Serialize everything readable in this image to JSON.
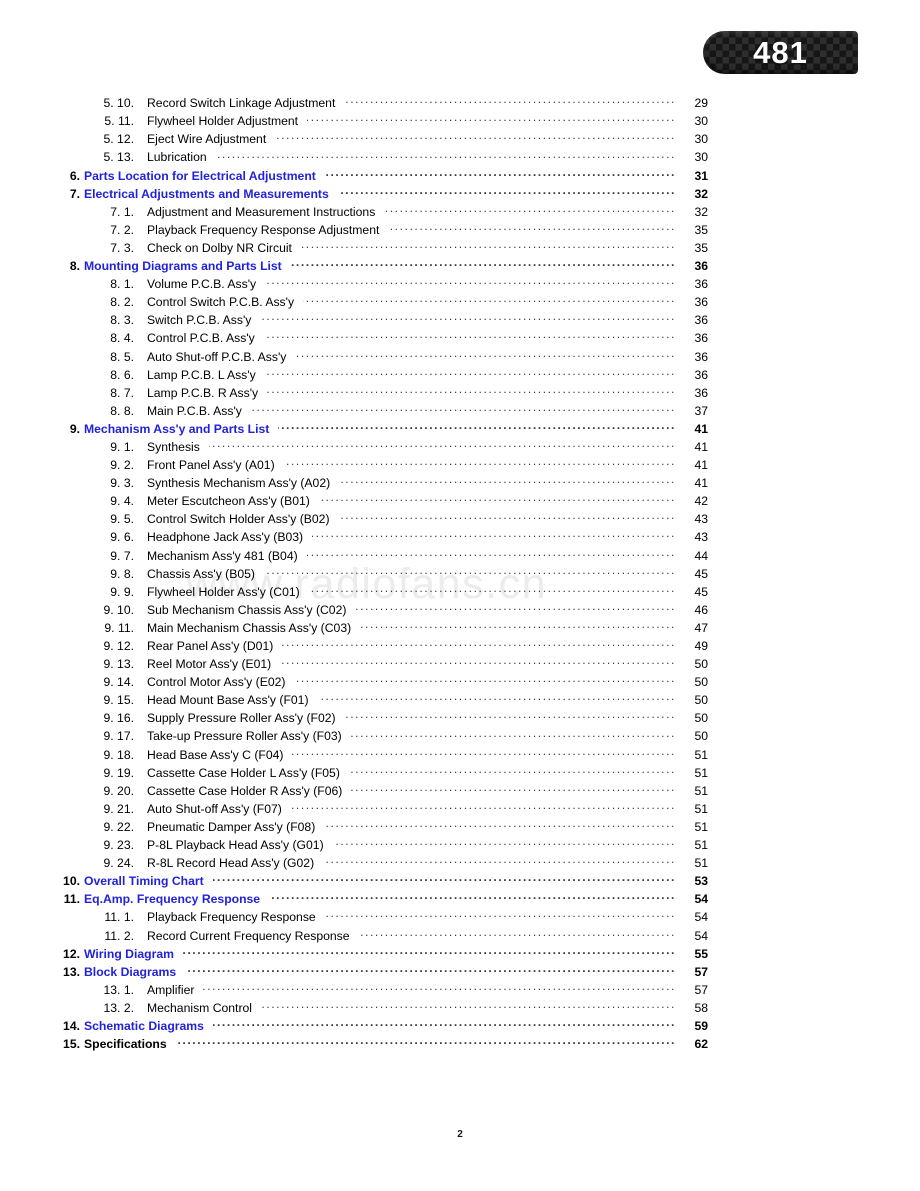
{
  "badge": {
    "number": "481"
  },
  "watermark": {
    "text": "www.radiofans.cn"
  },
  "footer": {
    "page_number": "2"
  },
  "colors": {
    "chapter_link": "#2222d8",
    "body_text": "#000000",
    "badge_background": "#161616",
    "badge_text": "#ffffff",
    "watermark": "#ececec"
  },
  "toc": {
    "rows": [
      {
        "level": 2,
        "num": "5. 10.",
        "title": "Record Switch Linkage Adjustment",
        "page": "29"
      },
      {
        "level": 2,
        "num": "5. 11.",
        "title": "Flywheel Holder Adjustment",
        "page": "30"
      },
      {
        "level": 2,
        "num": "5. 12.",
        "title": "Eject Wire Adjustment",
        "page": "30"
      },
      {
        "level": 2,
        "num": "5. 13.",
        "title": "Lubrication",
        "page": "30"
      },
      {
        "level": 1,
        "num": "6.",
        "title": "Parts Location for Electrical Adjustment",
        "page": "31",
        "link": true
      },
      {
        "level": 1,
        "num": "7.",
        "title": "Electrical Adjustments and Measurements",
        "page": "32",
        "link": true
      },
      {
        "level": 2,
        "num": "7. 1.",
        "title": "Adjustment and Measurement Instructions",
        "page": "32"
      },
      {
        "level": 2,
        "num": "7. 2.",
        "title": "Playback Frequency Response Adjustment",
        "page": "35"
      },
      {
        "level": 2,
        "num": "7. 3.",
        "title": "Check on Dolby NR Circuit",
        "page": "35"
      },
      {
        "level": 1,
        "num": "8.",
        "title": "Mounting Diagrams and Parts List",
        "page": "36",
        "link": true
      },
      {
        "level": 2,
        "num": "8. 1.",
        "title": "Volume P.C.B. Ass'y",
        "page": "36"
      },
      {
        "level": 2,
        "num": "8. 2.",
        "title": "Control Switch P.C.B. Ass'y",
        "page": "36"
      },
      {
        "level": 2,
        "num": "8. 3.",
        "title": "Switch P.C.B. Ass'y",
        "page": "36"
      },
      {
        "level": 2,
        "num": "8. 4.",
        "title": "Control P.C.B. Ass'y",
        "page": "36"
      },
      {
        "level": 2,
        "num": "8. 5.",
        "title": "Auto Shut-off P.C.B. Ass'y",
        "page": "36"
      },
      {
        "level": 2,
        "num": "8. 6.",
        "title": "Lamp P.C.B. L Ass'y",
        "page": "36"
      },
      {
        "level": 2,
        "num": "8. 7.",
        "title": "Lamp P.C.B. R Ass'y",
        "page": "36"
      },
      {
        "level": 2,
        "num": "8. 8.",
        "title": "Main P.C.B. Ass'y",
        "page": "37"
      },
      {
        "level": 1,
        "num": "9.",
        "title": "Mechanism Ass'y and Parts List",
        "page": "41",
        "link": true
      },
      {
        "level": 2,
        "num": "9. 1.",
        "title": "Synthesis",
        "page": "41"
      },
      {
        "level": 2,
        "num": "9. 2.",
        "title": "Front Panel Ass'y (A01)",
        "page": "41"
      },
      {
        "level": 2,
        "num": "9. 3.",
        "title": "Synthesis Mechanism Ass'y (A02)",
        "page": "41"
      },
      {
        "level": 2,
        "num": "9. 4.",
        "title": "Meter Escutcheon Ass'y (B01)",
        "page": "42"
      },
      {
        "level": 2,
        "num": "9. 5.",
        "title": "Control Switch Holder Ass'y (B02)",
        "page": "43"
      },
      {
        "level": 2,
        "num": "9. 6.",
        "title": "Headphone Jack Ass'y (B03)",
        "page": "43"
      },
      {
        "level": 2,
        "num": "9. 7.",
        "title": "Mechanism Ass'y 481 (B04)",
        "page": "44"
      },
      {
        "level": 2,
        "num": "9. 8.",
        "title": "Chassis Ass'y (B05)",
        "page": "45"
      },
      {
        "level": 2,
        "num": "9. 9.",
        "title": "Flywheel Holder Ass'y (C01)",
        "page": "45"
      },
      {
        "level": 2,
        "num": "9. 10.",
        "title": "Sub Mechanism Chassis Ass'y (C02)",
        "page": "46"
      },
      {
        "level": 2,
        "num": "9. 11.",
        "title": "Main Mechanism Chassis Ass'y (C03)",
        "page": "47"
      },
      {
        "level": 2,
        "num": "9. 12.",
        "title": "Rear Panel Ass'y (D01)",
        "page": "49"
      },
      {
        "level": 2,
        "num": "9. 13.",
        "title": "Reel Motor Ass'y (E01)",
        "page": "50"
      },
      {
        "level": 2,
        "num": "9. 14.",
        "title": "Control Motor Ass'y (E02)",
        "page": "50"
      },
      {
        "level": 2,
        "num": "9. 15.",
        "title": "Head Mount Base Ass'y (F01)",
        "page": "50"
      },
      {
        "level": 2,
        "num": "9. 16.",
        "title": "Supply Pressure Roller Ass'y (F02)",
        "page": "50"
      },
      {
        "level": 2,
        "num": "9. 17.",
        "title": "Take-up Pressure Roller Ass'y (F03)",
        "page": "50"
      },
      {
        "level": 2,
        "num": "9. 18.",
        "title": "Head Base Ass'y C (F04)",
        "page": "51"
      },
      {
        "level": 2,
        "num": "9. 19.",
        "title": "Cassette Case Holder L Ass'y (F05)",
        "page": "51"
      },
      {
        "level": 2,
        "num": "9. 20.",
        "title": "Cassette Case Holder R Ass'y (F06)",
        "page": "51"
      },
      {
        "level": 2,
        "num": "9. 21.",
        "title": "Auto Shut-off Ass'y (F07)",
        "page": "51"
      },
      {
        "level": 2,
        "num": "9. 22.",
        "title": "Pneumatic Damper Ass'y (F08)",
        "page": "51"
      },
      {
        "level": 2,
        "num": "9. 23.",
        "title": "P-8L Playback Head Ass'y (G01)",
        "page": "51"
      },
      {
        "level": 2,
        "num": "9. 24.",
        "title": "R-8L Record Head Ass'y (G02)",
        "page": "51"
      },
      {
        "level": 1,
        "num": "10.",
        "title": "Overall Timing Chart",
        "page": "53",
        "link": true
      },
      {
        "level": 1,
        "num": "11.",
        "title": "Eq.Amp. Frequency Response",
        "page": "54",
        "link": true
      },
      {
        "level": 2,
        "num": "11. 1.",
        "title": "Playback Frequency Response",
        "page": "54"
      },
      {
        "level": 2,
        "num": "11. 2.",
        "title": "Record Current Frequency Response",
        "page": "54"
      },
      {
        "level": 1,
        "num": "12.",
        "title": "Wiring Diagram",
        "page": "55",
        "link": true
      },
      {
        "level": 1,
        "num": "13.",
        "title": "Block Diagrams",
        "page": "57",
        "link": true
      },
      {
        "level": 2,
        "num": "13. 1.",
        "title": "Amplifier",
        "page": "57"
      },
      {
        "level": 2,
        "num": "13. 2.",
        "title": "Mechanism Control",
        "page": "58"
      },
      {
        "level": 1,
        "num": "14.",
        "title": "Schematic Diagrams",
        "page": "59",
        "link": true
      },
      {
        "level": 1,
        "num": "15.",
        "title": "Specifications",
        "page": "62",
        "link": false
      }
    ]
  }
}
